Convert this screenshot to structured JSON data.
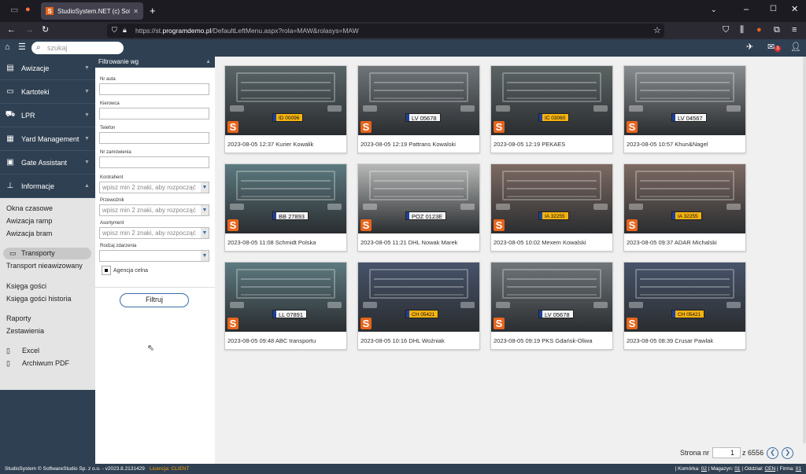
{
  "browser": {
    "tab_title": "StudioSystem.NET (c) SoftwareStudio",
    "url_prefix": "https://st.",
    "url_domain": "programdemo.pl",
    "url_rest": "/DefaultLeftMenu.aspx?rola=MAW&rolasys=MAW"
  },
  "appbar": {
    "search_placeholder": "szukaj",
    "mail_count": "3"
  },
  "sidebar": {
    "menu": [
      {
        "label": "Awizacje",
        "icon": "clipboard-icon"
      },
      {
        "label": "Kartoteki",
        "icon": "folder-icon"
      },
      {
        "label": "LPR",
        "icon": "truck-icon"
      },
      {
        "label": "Yard Management",
        "icon": "yard-icon"
      },
      {
        "label": "Gate Assistant",
        "icon": "monitor-icon"
      },
      {
        "label": "Informacje",
        "icon": "sitemap-icon"
      }
    ],
    "sub": [
      "Okna czasowe",
      "Awizacja ramp",
      "Awizacja bram",
      "Transporty",
      "Transport nieawizowany",
      "Księga gości",
      "Księga gości historia",
      "Raporty",
      "Zestawienia",
      "Excel",
      "Archiwum PDF"
    ]
  },
  "filter": {
    "title": "Filtrowanie wg",
    "fields": {
      "nr_auta": "Nr auta",
      "kierowca": "Kierowca",
      "telefon": "Telefon",
      "nr_zamowienia": "Nr zamówienia",
      "kontrahent": "Kontrahent",
      "przewoznik": "Przewoźnik",
      "asortyment": "Asortyment",
      "rodzaj_zdarzenia": "Rodzaj zdarzenia"
    },
    "placeholder": "wpisz min 2 znaki, aby rozpocząć",
    "checkbox_label": "Agencja celna",
    "button": "Filtruj"
  },
  "cards": [
    {
      "plate": "ID 00096",
      "plate_style": "yellow",
      "bg": "#5a6568",
      "caption": "2023-08-05 12:37 Kurier Kowalik"
    },
    {
      "plate": "LV 05678",
      "plate_style": "white",
      "bg": "#6f7579",
      "caption": "2023-08-05 12:19 Pattrans Kowalski"
    },
    {
      "plate": "IC 03060",
      "plate_style": "yellow",
      "bg": "#5c6464",
      "caption": "2023-08-05 12:19 PEKAES"
    },
    {
      "plate": "LV 04567",
      "plate_style": "white",
      "bg": "#8a8d90",
      "caption": "2023-08-05 10:57 Khun&Nagel"
    },
    {
      "plate": "BB 27893",
      "plate_style": "white",
      "bg": "#5c7a80",
      "caption": "2023-08-05 11:08 Schmidt Polska"
    },
    {
      "plate": "POZ 0123E",
      "plate_style": "white",
      "bg": "#b7b9b8",
      "caption": "2023-08-05 11:21 DHL Nowak Marek"
    },
    {
      "plate": "IA 32255",
      "plate_style": "yellow",
      "bg": "#7d6a63",
      "caption": "2023-08-05 10:02 Mexem Kowalski"
    },
    {
      "plate": "IA 32255",
      "plate_style": "yellow",
      "bg": "#7d6a63",
      "caption": "2023-08-05 09:37 ADAR Michalski"
    },
    {
      "plate": "LL 07891",
      "plate_style": "white",
      "bg": "#5d7a80",
      "caption": "2023-08-05 09:48 ABC transportu"
    },
    {
      "plate": "CH 05421",
      "plate_style": "yellow",
      "bg": "#47536a",
      "caption": "2023-08-05 10:16 DHL Woźniak"
    },
    {
      "plate": "LV 05678",
      "plate_style": "white",
      "bg": "#6f7579",
      "caption": "2023-08-05 09:19 PKS Gdańsk-Oliwa"
    },
    {
      "plate": "CH 05421",
      "plate_style": "yellow",
      "bg": "#47536a",
      "caption": "2023-08-05 08:39 Crusar Pawlak"
    }
  ],
  "pager": {
    "label": "Strona nr",
    "current": "1",
    "of": "z 6556"
  },
  "status": {
    "left": "StudioSystem © SoftwareStudio Sp. z o.o. - v2023.8.2131429",
    "license": "Licencja: CLIENT",
    "komorka_label": "| Komórka:",
    "komorka": "02",
    "magazyn_label": "| Magazyn:",
    "magazyn": "01",
    "oddzial_label": "| Oddział:",
    "oddzial": "CEN",
    "firma_label": "| Firma:",
    "firma": "01"
  },
  "colors": {
    "brand": "#e8641b",
    "sidebar": "#2f4052",
    "accent": "#3a6ea5"
  }
}
